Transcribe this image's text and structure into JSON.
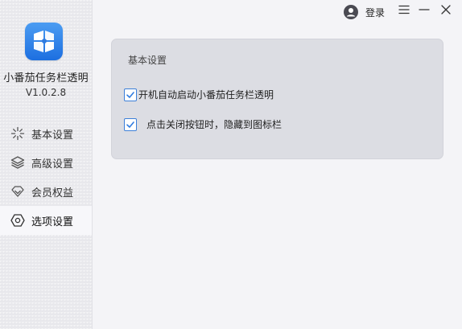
{
  "app": {
    "name": "小番茄任务栏透明",
    "version": "V1.0.2.8"
  },
  "titlebar": {
    "login_label": "登录",
    "icons": [
      "user-icon",
      "menu-icon",
      "minimize-icon",
      "close-icon"
    ]
  },
  "sidebar": {
    "items": [
      {
        "label": "基本设置",
        "icon": "sparkle-icon",
        "active": false
      },
      {
        "label": "高级设置",
        "icon": "layers-icon",
        "active": false
      },
      {
        "label": "会员权益",
        "icon": "diamond-icon",
        "active": false
      },
      {
        "label": "选项设置",
        "icon": "hexagon-settings-icon",
        "active": true
      }
    ]
  },
  "panel": {
    "title": "基本设置",
    "options": [
      {
        "label": "开机自动启动小番茄任务栏透明",
        "checked": true
      },
      {
        "label": "点击关闭按钮时，隐藏到图标栏",
        "checked": true
      }
    ]
  },
  "colors": {
    "accent": "#2f7be0",
    "sidebar_bg": "#e8e8ec",
    "panel_bg": "#dcdde3",
    "active_item_bg": "#f7f7fa"
  }
}
